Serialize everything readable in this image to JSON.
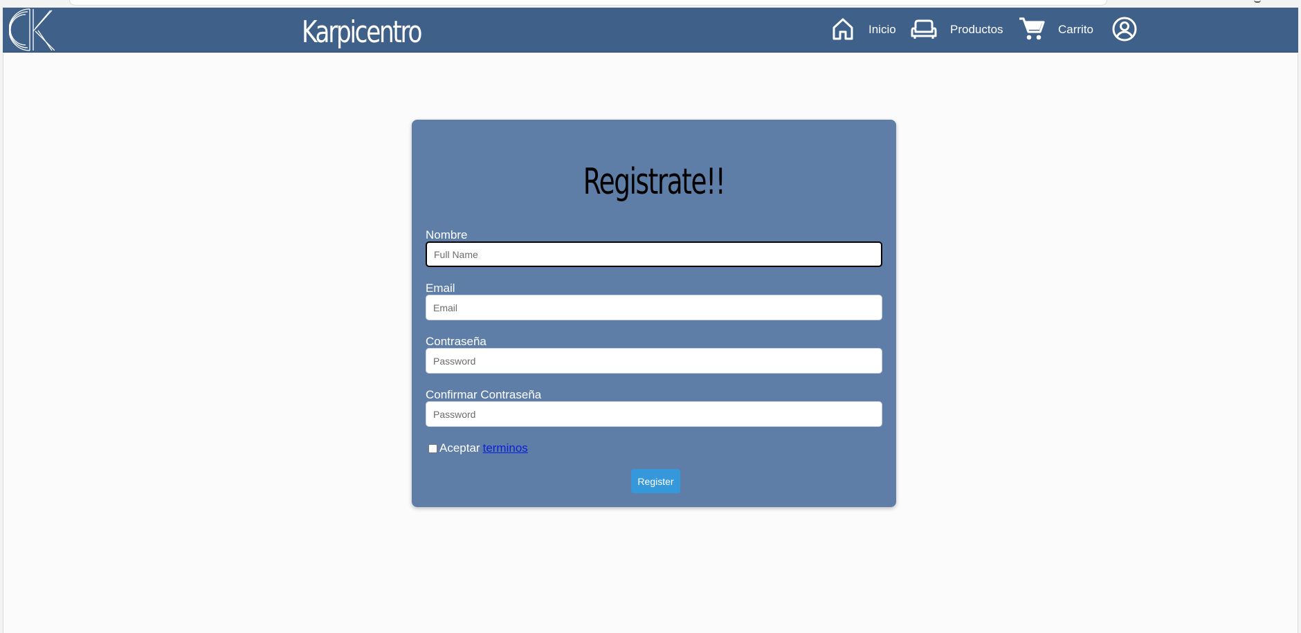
{
  "header": {
    "brand": "Karpicentro",
    "nav": [
      {
        "icon": "home-icon",
        "label": "Inicio"
      },
      {
        "icon": "sofa-icon",
        "label": "Productos"
      },
      {
        "icon": "cart-icon",
        "label": "Carrito"
      },
      {
        "icon": "user-circle-icon",
        "label": ""
      }
    ],
    "logo": "K"
  },
  "form": {
    "title": "Registrate!!",
    "fields": [
      {
        "label": "Nombre",
        "placeholder": "Full Name",
        "value": ""
      },
      {
        "label": "Email",
        "placeholder": "Email",
        "value": ""
      },
      {
        "label": "Contraseña",
        "placeholder": "Password",
        "value": ""
      },
      {
        "label": "Confirmar Contraseña",
        "placeholder": "Password",
        "value": ""
      }
    ],
    "terms_prefix": "Aceptar",
    "terms_link": "terminos",
    "submit": "Register"
  },
  "colors": {
    "navbar": "#3e6089",
    "card": "#5e7ea8",
    "button": "#3598db"
  }
}
